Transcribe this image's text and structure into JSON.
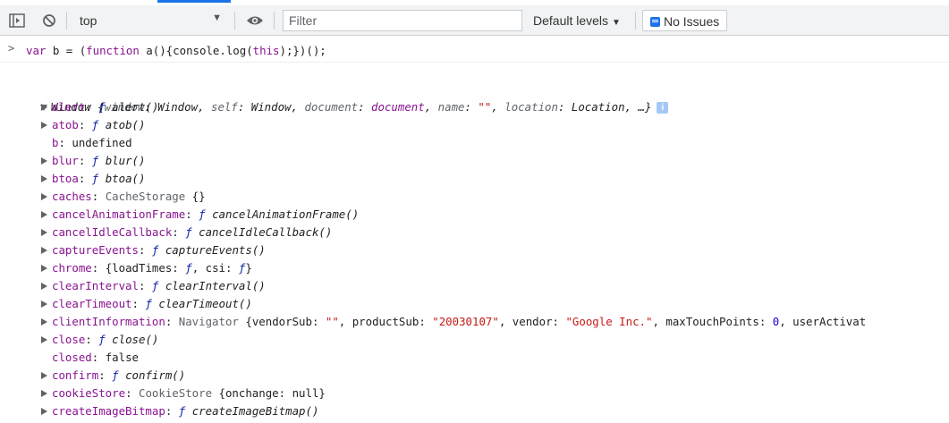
{
  "toolbar": {
    "context": "top",
    "filter_placeholder": "Filter",
    "levels": "Default levels",
    "issues": "No Issues"
  },
  "input": {
    "kw_var": "var",
    "pre": " b = (",
    "kw_function": "function",
    "fn_name": " a",
    "rest_a": "(){console.log(",
    "kw_this": "this",
    "rest_b": ");})();"
  },
  "window_summary": {
    "name": "Window",
    "preview_open": " {",
    "p1k": "window",
    "p1v": "Window",
    "p2k": "self",
    "p2v": "Window",
    "p3k": "document",
    "p3v": "document",
    "p4k": "name",
    "p4v": "\"\"",
    "p5k": "location",
    "p5v": "Location",
    "tail": ", …}",
    "info": "i"
  },
  "properties": [
    {
      "key": "alert",
      "sep": ": ",
      "kind": "f",
      "val": "alert()",
      "expand": true
    },
    {
      "key": "atob",
      "sep": ": ",
      "kind": "f",
      "val": "atob()",
      "expand": true
    },
    {
      "key": "b",
      "sep": ": ",
      "kind": "plain",
      "val": "undefined",
      "expand": false
    },
    {
      "key": "blur",
      "sep": ": ",
      "kind": "f",
      "val": "blur()",
      "expand": true
    },
    {
      "key": "btoa",
      "sep": ": ",
      "kind": "f",
      "val": "btoa()",
      "expand": true
    },
    {
      "key": "caches",
      "sep": ": ",
      "kind": "plain",
      "val": "CacheStorage {}",
      "expand": true
    },
    {
      "key": "cancelAnimationFrame",
      "sep": ": ",
      "kind": "f",
      "val": "cancelAnimationFrame()",
      "expand": true
    },
    {
      "key": "cancelIdleCallback",
      "sep": ": ",
      "kind": "f",
      "val": "cancelIdleCallback()",
      "expand": true
    },
    {
      "key": "captureEvents",
      "sep": ": ",
      "kind": "f",
      "val": "captureEvents()",
      "expand": true
    },
    {
      "key": "chrome",
      "sep": ": ",
      "kind": "plain",
      "val": "{loadTimes: ƒ, csi: ƒ}",
      "expand": true
    },
    {
      "key": "clearInterval",
      "sep": ": ",
      "kind": "f",
      "val": "clearInterval()",
      "expand": true
    },
    {
      "key": "clearTimeout",
      "sep": ": ",
      "kind": "f",
      "val": "clearTimeout()",
      "expand": true
    },
    {
      "key": "clientInformation",
      "sep": ": ",
      "kind": "navigator",
      "val": "Navigator {vendorSub: \"\", productSub: \"20030107\", vendor: \"Google Inc.\", maxTouchPoints: 0, userActivat",
      "expand": true
    },
    {
      "key": "close",
      "sep": ": ",
      "kind": "f",
      "val": "close()",
      "expand": true
    },
    {
      "key": "closed",
      "sep": ": ",
      "kind": "plain",
      "val": "false",
      "expand": false
    },
    {
      "key": "confirm",
      "sep": ": ",
      "kind": "f",
      "val": "confirm()",
      "expand": true
    },
    {
      "key": "cookieStore",
      "sep": ": ",
      "kind": "plain",
      "val": "CookieStore {onchange: null}",
      "expand": true
    },
    {
      "key": "createImageBitmap",
      "sep": ": ",
      "kind": "f",
      "val": "createImageBitmap()",
      "expand": true
    }
  ],
  "symbols": {
    "f": "ƒ"
  },
  "navigator_parts": {
    "type": "Navigator",
    "open": " {",
    "k1": "vendorSub",
    "v1": "\"\"",
    "k2": "productSub",
    "v2": "\"20030107\"",
    "k3": "vendor",
    "v3": "\"Google Inc.\"",
    "k4": "maxTouchPoints",
    "v4": "0",
    "k5": "userActivat"
  },
  "chrome_parts": {
    "open": "{",
    "k1": "loadTimes",
    "k2": "csi",
    "close": "}"
  },
  "cookie_parts": {
    "type": "CookieStore",
    "open": " {",
    "k1": "onchange",
    "v1": "null",
    "close": "}"
  },
  "caches_parts": {
    "type": "CacheStorage",
    "braces": " {}"
  }
}
